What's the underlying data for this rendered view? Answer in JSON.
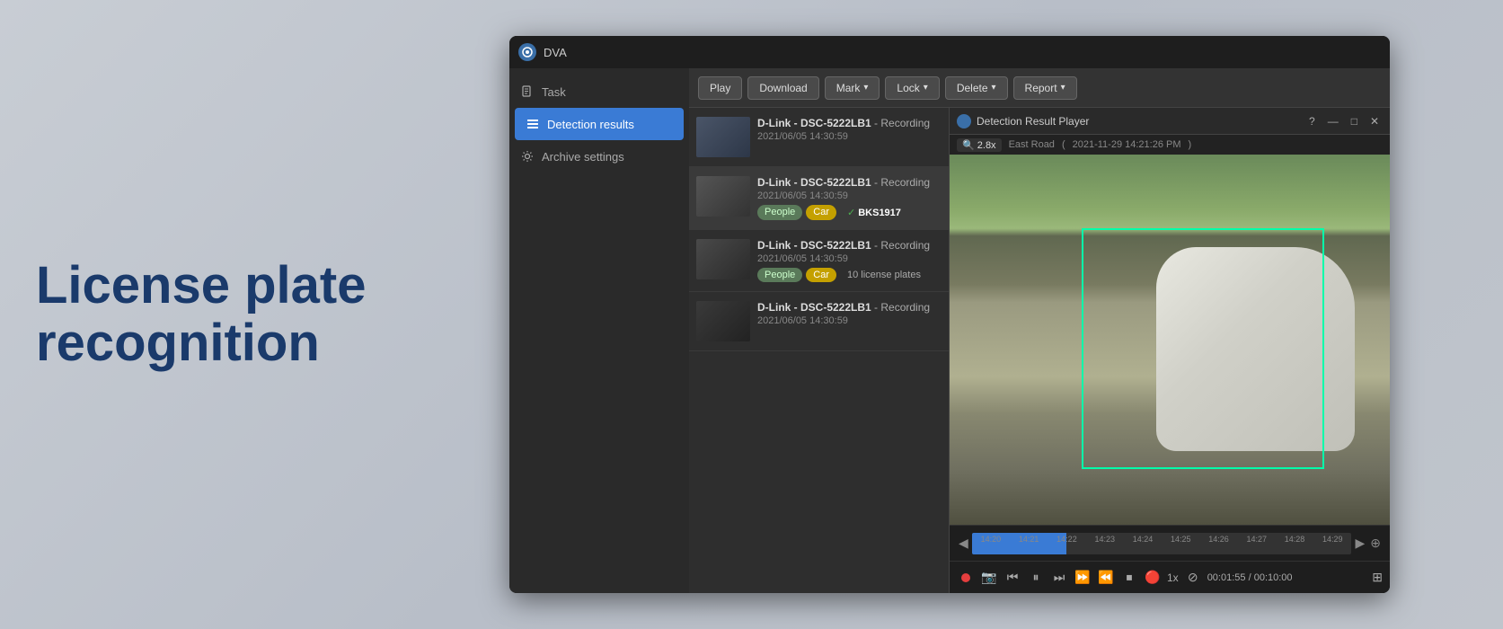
{
  "left": {
    "line1": "License plate",
    "line2": "recognition"
  },
  "app": {
    "title": "DVA",
    "sidebar": {
      "items": [
        {
          "label": "Task",
          "icon": "file-icon",
          "active": false
        },
        {
          "label": "Detection results",
          "icon": "list-icon",
          "active": true
        },
        {
          "label": "Archive settings",
          "icon": "gear-icon",
          "active": false
        }
      ]
    },
    "toolbar": {
      "buttons": [
        {
          "label": "Play",
          "has_arrow": false
        },
        {
          "label": "Download",
          "has_arrow": false
        },
        {
          "label": "Mark",
          "has_arrow": true
        },
        {
          "label": "Lock",
          "has_arrow": true
        },
        {
          "label": "Delete",
          "has_arrow": true
        },
        {
          "label": "Report",
          "has_arrow": true
        }
      ]
    },
    "detection_list": {
      "items": [
        {
          "camera": "D-Link - DSC-5222LB1",
          "type": "Recording",
          "date": "2021/06/05 14:30:59",
          "tags": []
        },
        {
          "camera": "D-Link - DSC-5222LB1",
          "type": "Recording",
          "date": "2021/06/05 14:30:59",
          "tags": [
            "People",
            "Car"
          ],
          "plate": "BKS1917",
          "plate_verified": true,
          "selected": true
        },
        {
          "camera": "D-Link - DSC-5222LB1",
          "type": "Recording",
          "date": "2021/06/05 14:30:59",
          "tags": [
            "People",
            "Car"
          ],
          "license_count": "10 license plates"
        },
        {
          "camera": "D-Link - DSC-5222LB1",
          "type": "Recording",
          "date": "2021/06/05 14:30:59",
          "tags": []
        }
      ]
    },
    "player": {
      "title": "Detection Result Player",
      "location": "East Road",
      "datetime": "2021-11-29 14:21:26 PM",
      "zoom": "2.8x",
      "timeline": {
        "labels": [
          "14:20",
          "14:21",
          "14:22",
          "14:23",
          "14:24",
          "14:25",
          "14:26",
          "14:27",
          "14:28",
          "14:29"
        ]
      },
      "time_current": "00:01:55",
      "time_total": "00:10:00",
      "speed": "1x"
    }
  }
}
